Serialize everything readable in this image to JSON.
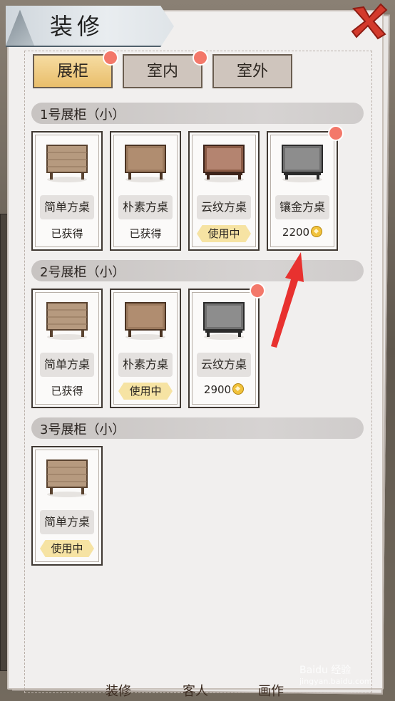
{
  "title": "装修",
  "tabs": [
    {
      "label": "展柜",
      "active": true,
      "badge": true
    },
    {
      "label": "室内",
      "active": false,
      "badge": true
    },
    {
      "label": "室外",
      "active": false,
      "badge": false
    }
  ],
  "sections": [
    {
      "title": "1号展柜（小）",
      "items": [
        {
          "name": "简单方桌",
          "status": "已获得",
          "style": "plain"
        },
        {
          "name": "朴素方桌",
          "status": "已获得",
          "style": "dark"
        },
        {
          "name": "云纹方桌",
          "status": "使用中",
          "style": "red"
        },
        {
          "name": "镶金方桌",
          "price": "2200",
          "style": "gray",
          "badge": true
        }
      ]
    },
    {
      "title": "2号展柜（小）",
      "items": [
        {
          "name": "简单方桌",
          "status": "已获得",
          "style": "plain"
        },
        {
          "name": "朴素方桌",
          "status": "使用中",
          "style": "dark"
        },
        {
          "name": "云纹方桌",
          "price": "2900",
          "style": "gray",
          "badge": true
        }
      ]
    },
    {
      "title": "3号展柜（小）",
      "items": [
        {
          "name": "简单方桌",
          "status": "使用中",
          "style": "plain"
        }
      ]
    }
  ],
  "watermark": {
    "line1": "Baidu 经验",
    "line2": "jingyan.baidu.com"
  },
  "bottom_labels": [
    "装修",
    "客人",
    "画作"
  ],
  "colors": {
    "accent": "#f6dca2",
    "badge": "#f3786a",
    "arrow": "#e8312f"
  }
}
